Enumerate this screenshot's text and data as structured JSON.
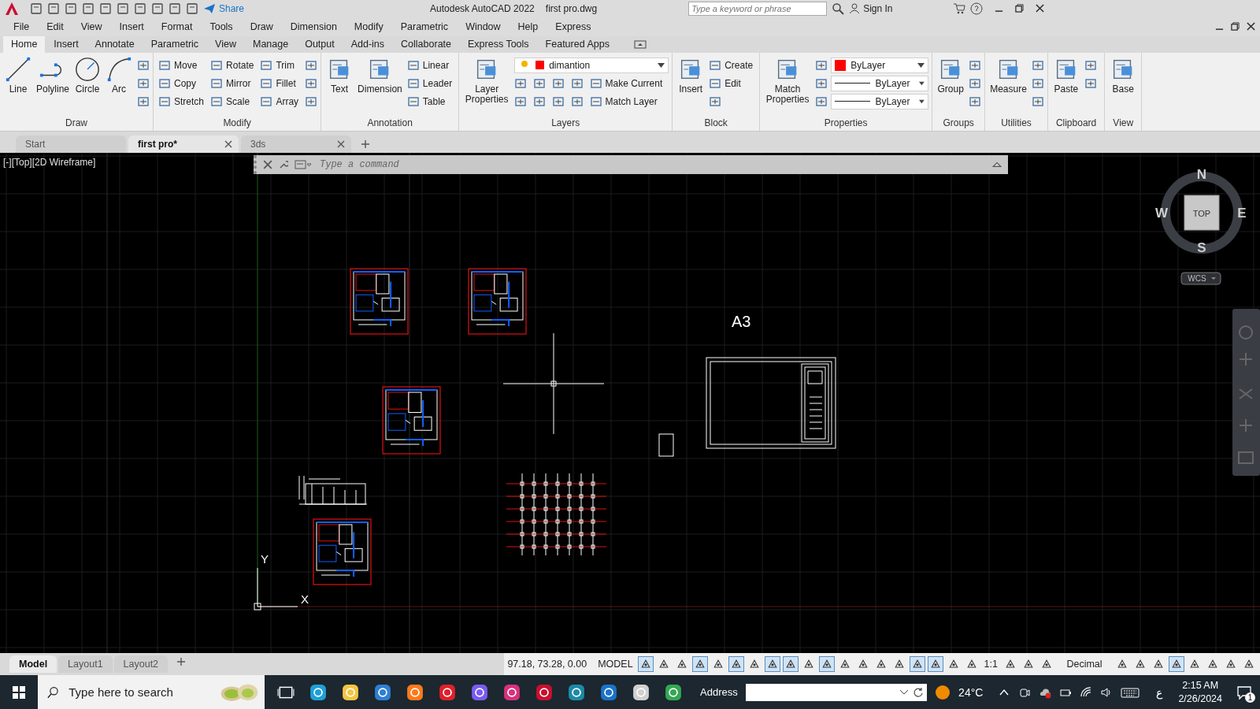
{
  "title_bar": {
    "share": "Share",
    "app_name": "Autodesk AutoCAD 2022",
    "file_name": "first pro.dwg",
    "search": {
      "placeholder": "Type a keyword or phrase"
    },
    "sign_in": "Sign In"
  },
  "menu_bar": [
    "File",
    "Edit",
    "View",
    "Insert",
    "Format",
    "Tools",
    "Draw",
    "Dimension",
    "Modify",
    "Parametric",
    "Window",
    "Help",
    "Express"
  ],
  "ribbon_tabs": [
    {
      "label": "Home",
      "selected": true
    },
    {
      "label": "Insert",
      "selected": false
    },
    {
      "label": "Annotate",
      "selected": false
    },
    {
      "label": "Parametric",
      "selected": false
    },
    {
      "label": "View",
      "selected": false
    },
    {
      "label": "Manage",
      "selected": false
    },
    {
      "label": "Output",
      "selected": false
    },
    {
      "label": "Add-ins",
      "selected": false
    },
    {
      "label": "Collaborate",
      "selected": false
    },
    {
      "label": "Express Tools",
      "selected": false
    },
    {
      "label": "Featured Apps",
      "selected": false
    }
  ],
  "ribbon_panels": [
    {
      "title": "Draw",
      "large": [
        "Line",
        "Polyline",
        "Circle",
        "Arc"
      ],
      "rows": [
        [
          {
            "kind": "icon"
          }
        ],
        [
          {
            "kind": "icon"
          }
        ],
        [
          {
            "kind": "icon"
          }
        ]
      ]
    },
    {
      "title": "Modify",
      "rows": [
        [
          {
            "kind": "small",
            "label": "Move"
          },
          {
            "kind": "small",
            "label": "Rotate"
          },
          {
            "kind": "small",
            "label": "Trim"
          },
          {
            "kind": "icon"
          }
        ],
        [
          {
            "kind": "small",
            "label": "Copy"
          },
          {
            "kind": "small",
            "label": "Mirror"
          },
          {
            "kind": "small",
            "label": "Fillet"
          },
          {
            "kind": "icon"
          }
        ],
        [
          {
            "kind": "small",
            "label": "Stretch"
          },
          {
            "kind": "small",
            "label": "Scale"
          },
          {
            "kind": "small",
            "label": "Array"
          },
          {
            "kind": "icon"
          }
        ]
      ]
    },
    {
      "title": "Annotation",
      "large": [
        "Text",
        "Dimension"
      ],
      "rows": [
        [
          {
            "kind": "small",
            "label": "Linear"
          }
        ],
        [
          {
            "kind": "small",
            "label": "Leader"
          }
        ],
        [
          {
            "kind": "small",
            "label": "Table"
          }
        ]
      ]
    },
    {
      "title": "Layers",
      "large": [
        "Layer Properties"
      ],
      "rows": [
        [
          {
            "kind": "layer",
            "value": "dimantion",
            "color": "#ff0000"
          }
        ],
        [
          {
            "kind": "icon"
          },
          {
            "kind": "icon"
          },
          {
            "kind": "icon"
          },
          {
            "kind": "icon"
          },
          {
            "kind": "small",
            "label": "Make Current"
          }
        ],
        [
          {
            "kind": "icon"
          },
          {
            "kind": "icon"
          },
          {
            "kind": "icon"
          },
          {
            "kind": "icon"
          },
          {
            "kind": "small",
            "label": "Match Layer"
          }
        ]
      ]
    },
    {
      "title": "Block",
      "large": [
        "Insert"
      ],
      "rows": [
        [
          {
            "kind": "small",
            "label": "Create"
          }
        ],
        [
          {
            "kind": "small",
            "label": "Edit"
          }
        ],
        [
          {
            "kind": "icon"
          }
        ]
      ]
    },
    {
      "title": "Properties",
      "large": [
        "Match Properties"
      ],
      "rows": [
        [
          {
            "kind": "icon"
          },
          {
            "kind": "swatch",
            "value": "ByLayer",
            "color": "#ff0000"
          }
        ],
        [
          {
            "kind": "icon"
          },
          {
            "kind": "linetype",
            "value": "ByLayer"
          }
        ],
        [
          {
            "kind": "icon"
          },
          {
            "kind": "linetype",
            "value": "ByLayer"
          }
        ]
      ]
    },
    {
      "title": "Groups",
      "large": [
        "Group"
      ],
      "rows": [
        [
          {
            "kind": "icon"
          }
        ],
        [
          {
            "kind": "icon"
          }
        ],
        [
          {
            "kind": "icon"
          }
        ]
      ]
    },
    {
      "title": "Utilities",
      "large": [
        "Measure"
      ],
      "rows": [
        [
          {
            "kind": "icon"
          }
        ],
        [
          {
            "kind": "icon"
          }
        ],
        [
          {
            "kind": "icon"
          }
        ]
      ]
    },
    {
      "title": "Clipboard",
      "large": [
        "Paste"
      ],
      "rows": [
        [
          {
            "kind": "icon"
          }
        ],
        [
          {
            "kind": "icon"
          }
        ]
      ]
    },
    {
      "title": "View",
      "large": [
        "Base"
      ]
    }
  ],
  "file_tabs": [
    {
      "label": "Start",
      "selected": false,
      "closable": false
    },
    {
      "label": "first pro*",
      "selected": true,
      "closable": true
    },
    {
      "label": "3ds",
      "selected": false,
      "closable": true
    }
  ],
  "viewport_label": "[-][Top][2D Wireframe]",
  "command_line": {
    "placeholder": "Type a command"
  },
  "canvas": {
    "sheet_label": "A3",
    "ucs_y": "Y",
    "ucs_x": "X"
  },
  "view_cube": {
    "north": "N",
    "south": "S",
    "west": "W",
    "east": "E",
    "face": "TOP",
    "coordinate_system": "WCS"
  },
  "layout_tabs": [
    {
      "label": "Model",
      "selected": true
    },
    {
      "label": "Layout1",
      "selected": false
    },
    {
      "label": "Layout2",
      "selected": false
    }
  ],
  "status_bar": {
    "coordinates": "97.18, 73.28, 0.00",
    "space": "MODEL",
    "toggles_a": [
      {
        "on": true
      },
      {
        "on": false
      },
      {
        "on": false
      },
      {
        "on": true
      },
      {
        "on": false
      },
      {
        "on": true
      },
      {
        "on": false
      },
      {
        "on": true
      },
      {
        "on": true
      },
      {
        "on": false
      },
      {
        "on": true
      },
      {
        "on": false
      },
      {
        "on": false
      },
      {
        "on": false
      },
      {
        "on": false
      },
      {
        "on": true
      },
      {
        "on": true
      },
      {
        "on": false
      },
      {
        "on": false
      }
    ],
    "scale": "1:1",
    "toggles_b": [
      {
        "on": false
      },
      {
        "on": false
      },
      {
        "on": false
      }
    ],
    "units": "Decimal",
    "toggles_c": [
      {
        "on": false
      },
      {
        "on": false
      },
      {
        "on": false
      },
      {
        "on": true
      },
      {
        "on": false
      },
      {
        "on": false
      },
      {
        "on": false
      },
      {
        "on": false
      }
    ]
  },
  "taskbar": {
    "search": {
      "placeholder": "Type here to search"
    },
    "address_label": "Address",
    "weather": "24°C",
    "keyboard": "ع",
    "time": "2:15 AM",
    "date": "2/26/2024",
    "notifications": "1"
  }
}
